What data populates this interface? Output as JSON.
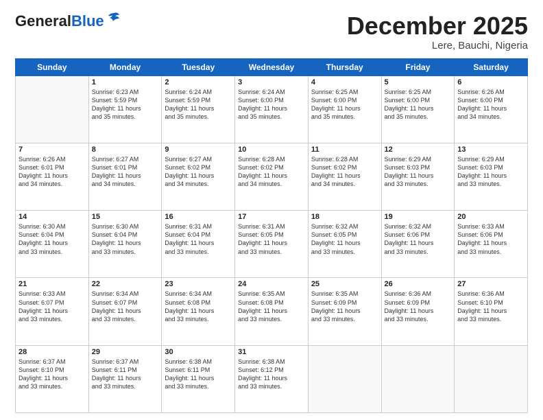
{
  "header": {
    "logo_general": "General",
    "logo_blue": "Blue",
    "month_title": "December 2025",
    "location": "Lere, Bauchi, Nigeria"
  },
  "weekdays": [
    "Sunday",
    "Monday",
    "Tuesday",
    "Wednesday",
    "Thursday",
    "Friday",
    "Saturday"
  ],
  "weeks": [
    [
      {
        "day": "",
        "info": ""
      },
      {
        "day": "1",
        "info": "Sunrise: 6:23 AM\nSunset: 5:59 PM\nDaylight: 11 hours\nand 35 minutes."
      },
      {
        "day": "2",
        "info": "Sunrise: 6:24 AM\nSunset: 5:59 PM\nDaylight: 11 hours\nand 35 minutes."
      },
      {
        "day": "3",
        "info": "Sunrise: 6:24 AM\nSunset: 6:00 PM\nDaylight: 11 hours\nand 35 minutes."
      },
      {
        "day": "4",
        "info": "Sunrise: 6:25 AM\nSunset: 6:00 PM\nDaylight: 11 hours\nand 35 minutes."
      },
      {
        "day": "5",
        "info": "Sunrise: 6:25 AM\nSunset: 6:00 PM\nDaylight: 11 hours\nand 35 minutes."
      },
      {
        "day": "6",
        "info": "Sunrise: 6:26 AM\nSunset: 6:00 PM\nDaylight: 11 hours\nand 34 minutes."
      }
    ],
    [
      {
        "day": "7",
        "info": "Sunrise: 6:26 AM\nSunset: 6:01 PM\nDaylight: 11 hours\nand 34 minutes."
      },
      {
        "day": "8",
        "info": "Sunrise: 6:27 AM\nSunset: 6:01 PM\nDaylight: 11 hours\nand 34 minutes."
      },
      {
        "day": "9",
        "info": "Sunrise: 6:27 AM\nSunset: 6:02 PM\nDaylight: 11 hours\nand 34 minutes."
      },
      {
        "day": "10",
        "info": "Sunrise: 6:28 AM\nSunset: 6:02 PM\nDaylight: 11 hours\nand 34 minutes."
      },
      {
        "day": "11",
        "info": "Sunrise: 6:28 AM\nSunset: 6:02 PM\nDaylight: 11 hours\nand 34 minutes."
      },
      {
        "day": "12",
        "info": "Sunrise: 6:29 AM\nSunset: 6:03 PM\nDaylight: 11 hours\nand 33 minutes."
      },
      {
        "day": "13",
        "info": "Sunrise: 6:29 AM\nSunset: 6:03 PM\nDaylight: 11 hours\nand 33 minutes."
      }
    ],
    [
      {
        "day": "14",
        "info": "Sunrise: 6:30 AM\nSunset: 6:04 PM\nDaylight: 11 hours\nand 33 minutes."
      },
      {
        "day": "15",
        "info": "Sunrise: 6:30 AM\nSunset: 6:04 PM\nDaylight: 11 hours\nand 33 minutes."
      },
      {
        "day": "16",
        "info": "Sunrise: 6:31 AM\nSunset: 6:04 PM\nDaylight: 11 hours\nand 33 minutes."
      },
      {
        "day": "17",
        "info": "Sunrise: 6:31 AM\nSunset: 6:05 PM\nDaylight: 11 hours\nand 33 minutes."
      },
      {
        "day": "18",
        "info": "Sunrise: 6:32 AM\nSunset: 6:05 PM\nDaylight: 11 hours\nand 33 minutes."
      },
      {
        "day": "19",
        "info": "Sunrise: 6:32 AM\nSunset: 6:06 PM\nDaylight: 11 hours\nand 33 minutes."
      },
      {
        "day": "20",
        "info": "Sunrise: 6:33 AM\nSunset: 6:06 PM\nDaylight: 11 hours\nand 33 minutes."
      }
    ],
    [
      {
        "day": "21",
        "info": "Sunrise: 6:33 AM\nSunset: 6:07 PM\nDaylight: 11 hours\nand 33 minutes."
      },
      {
        "day": "22",
        "info": "Sunrise: 6:34 AM\nSunset: 6:07 PM\nDaylight: 11 hours\nand 33 minutes."
      },
      {
        "day": "23",
        "info": "Sunrise: 6:34 AM\nSunset: 6:08 PM\nDaylight: 11 hours\nand 33 minutes."
      },
      {
        "day": "24",
        "info": "Sunrise: 6:35 AM\nSunset: 6:08 PM\nDaylight: 11 hours\nand 33 minutes."
      },
      {
        "day": "25",
        "info": "Sunrise: 6:35 AM\nSunset: 6:09 PM\nDaylight: 11 hours\nand 33 minutes."
      },
      {
        "day": "26",
        "info": "Sunrise: 6:36 AM\nSunset: 6:09 PM\nDaylight: 11 hours\nand 33 minutes."
      },
      {
        "day": "27",
        "info": "Sunrise: 6:36 AM\nSunset: 6:10 PM\nDaylight: 11 hours\nand 33 minutes."
      }
    ],
    [
      {
        "day": "28",
        "info": "Sunrise: 6:37 AM\nSunset: 6:10 PM\nDaylight: 11 hours\nand 33 minutes."
      },
      {
        "day": "29",
        "info": "Sunrise: 6:37 AM\nSunset: 6:11 PM\nDaylight: 11 hours\nand 33 minutes."
      },
      {
        "day": "30",
        "info": "Sunrise: 6:38 AM\nSunset: 6:11 PM\nDaylight: 11 hours\nand 33 minutes."
      },
      {
        "day": "31",
        "info": "Sunrise: 6:38 AM\nSunset: 6:12 PM\nDaylight: 11 hours\nand 33 minutes."
      },
      {
        "day": "",
        "info": ""
      },
      {
        "day": "",
        "info": ""
      },
      {
        "day": "",
        "info": ""
      }
    ]
  ]
}
